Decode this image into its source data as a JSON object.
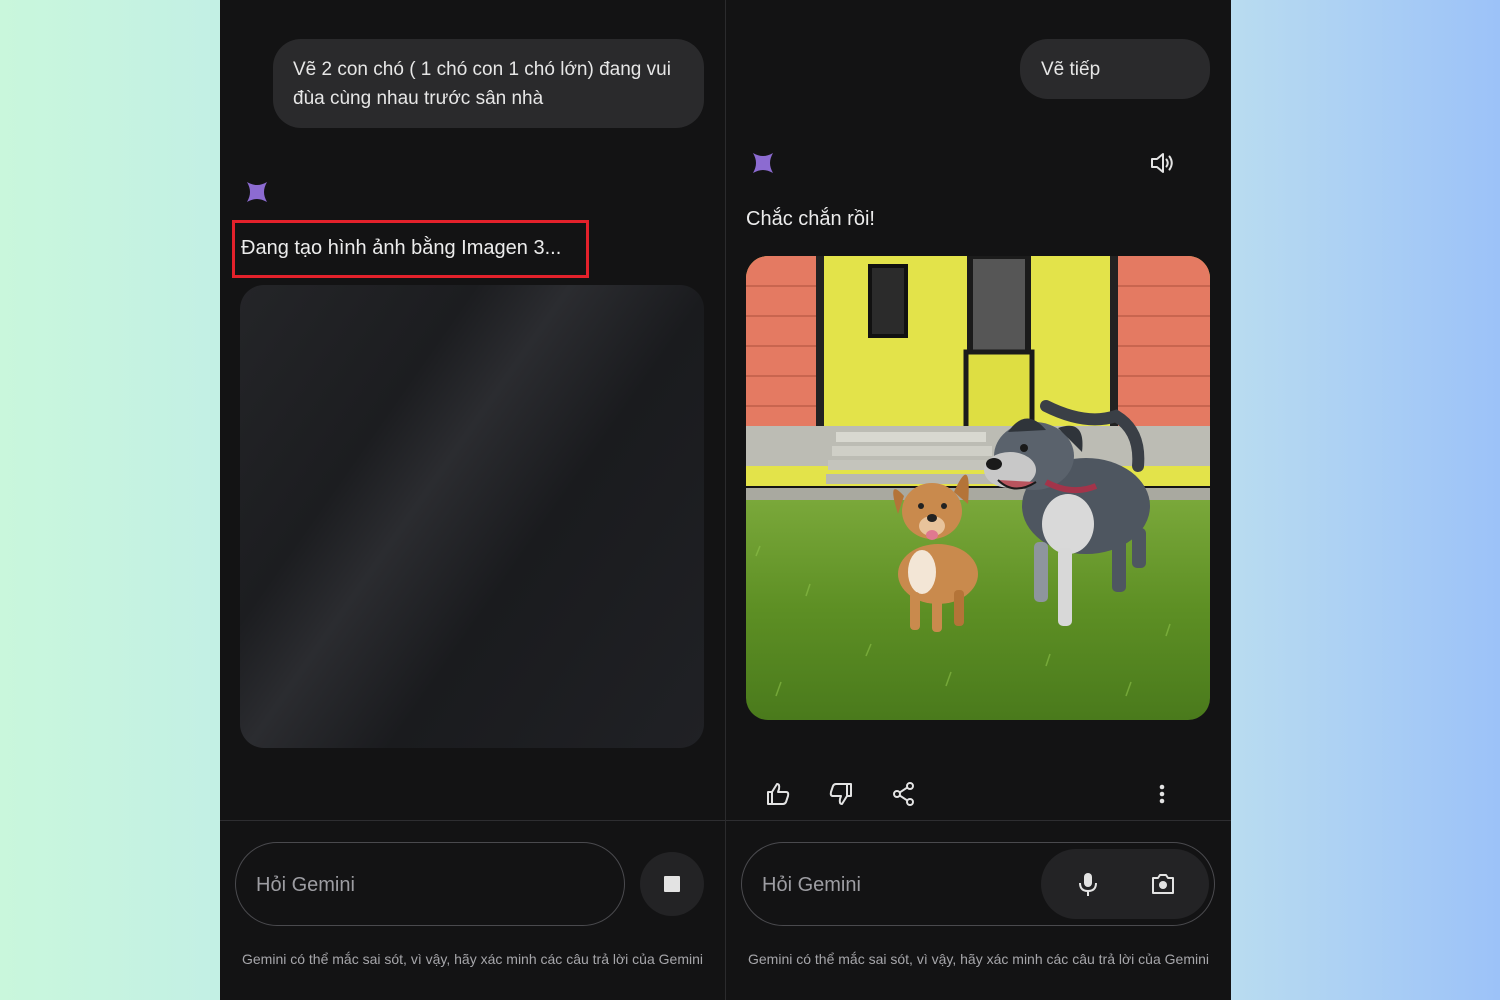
{
  "left_panel": {
    "user_prompt": "Vẽ 2 con chó ( 1 chó con 1 chó lớn) đang vui đùa cùng nhau trước sân nhà",
    "status_text": "Đang tạo hình ảnh bằng Imagen 3...",
    "input_placeholder": "Hỏi Gemini",
    "disclaimer": "Gemini có thể mắc sai sót, vì vậy, hãy xác minh các câu trả lời của Gemini"
  },
  "right_panel": {
    "user_prompt": "Vẽ tiếp",
    "response_text": "Chắc chắn rồi!",
    "input_placeholder": "Hỏi Gemini",
    "disclaimer": "Gemini có thể mắc sai sót, vì vậy, hãy xác minh các câu trả lời của Gemini"
  },
  "colors": {
    "panel_bg": "#131314",
    "bubble_bg": "#2a2a2c",
    "sparkle": "#8c6bd1",
    "highlight": "#e3212b"
  },
  "icons": [
    "gemini-sparkle-icon",
    "speaker-icon",
    "thumbs-up-icon",
    "thumbs-down-icon",
    "share-icon",
    "more-vert-icon",
    "stop-icon",
    "mic-icon",
    "camera-icon"
  ]
}
